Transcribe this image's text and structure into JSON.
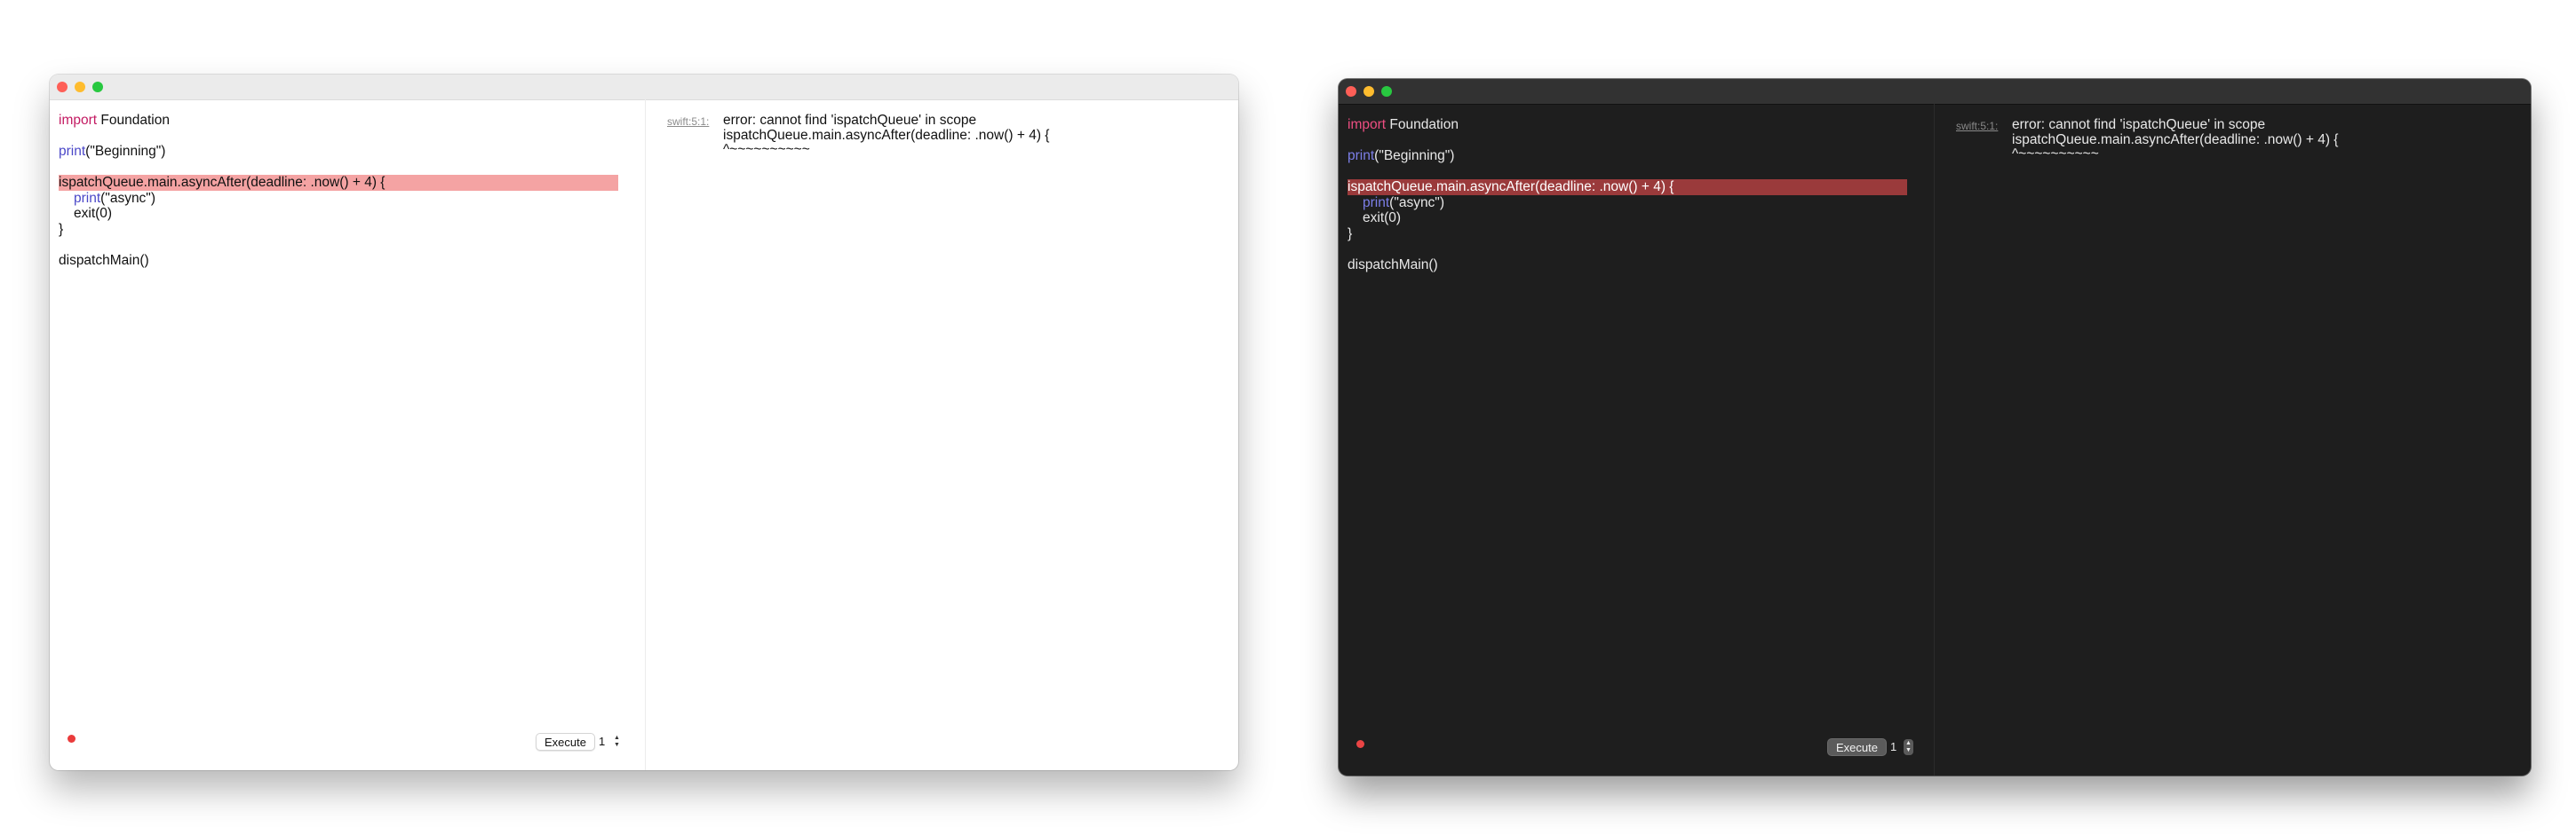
{
  "code": {
    "line1": {
      "keyword": "import",
      "rest": " Foundation"
    },
    "line2": {
      "keyword": "print",
      "rest": "(\"Beginning\")"
    },
    "line3": "ispatchQueue.main.asyncAfter(deadline: .now() + 4) {",
    "line4": {
      "keyword": "print",
      "rest": "(\"async\")"
    },
    "line5": "exit(0)",
    "line6": "}",
    "line7": "dispatchMain()"
  },
  "output": {
    "location": "swift:5:1:",
    "lines": [
      "error: cannot find 'ispatchQueue' in scope",
      "ispatchQueue.main.asyncAfter(deadline: .now() + 4) {",
      "^~~~~~~~~~~"
    ]
  },
  "controls": {
    "execute_label": "Execute",
    "count_value": "1",
    "stepper_glyph": "⌃⌄"
  },
  "colors": {
    "error_highlight_light": "#f4a3a3",
    "error_highlight_dark": "#9a3a3b",
    "keyword_import": "#c31a62",
    "keyword_print": "#4b48c8",
    "status_error": "#ea3b3b"
  },
  "icons": {
    "close": "close-traffic-light-icon",
    "minimize": "minimize-traffic-light-icon",
    "zoom": "zoom-traffic-light-icon",
    "status": "status-error-dot-icon",
    "stepper": "stepper-icon"
  }
}
